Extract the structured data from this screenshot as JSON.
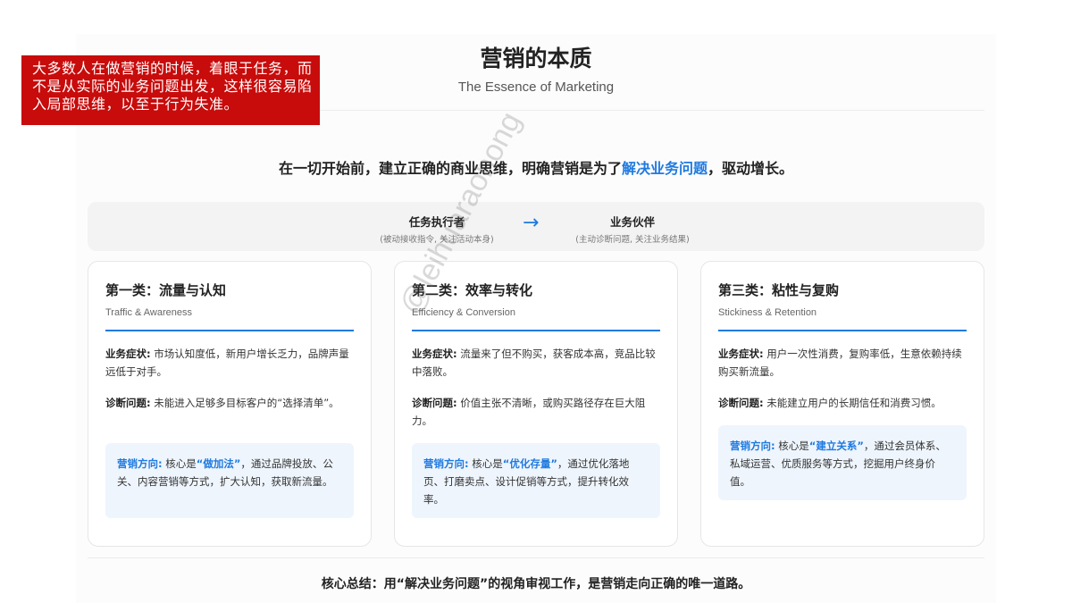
{
  "note": {
    "text": "大多数人在做营销的时候，着眼于任务，而不是从实际的业务问题出发，这样很容易陷入局部思维，以至于行为失准。"
  },
  "header": {
    "title": "营销的本质",
    "subtitle": "The Essence of Marketing"
  },
  "lead": {
    "before": "在一切开始前，建立正确的商业思维，明确营销是为了",
    "highlight": "解决业务问题",
    "after": "，驱动增长。"
  },
  "shift": {
    "from_title": "任务执行者",
    "from_desc": "(被动接收指令, 关注活动本身)",
    "arrow": "→",
    "to_title": "业务伙伴",
    "to_desc": "(主动诊断问题, 关注业务结果)"
  },
  "cards": [
    {
      "title": "第一类：流量与认知",
      "subtitle": "Traffic & Awareness",
      "symptom_label": "业务症状:",
      "symptom": " 市场认知度低，新用户增长乏力，品牌声量远低于对手。",
      "diagnosis_label": "诊断问题:",
      "diagnosis": " 未能进入足够多目标客户的“选择清单”。",
      "direction_label": "营销方向:",
      "direction_pre": " 核心是",
      "direction_kw": "“做加法”",
      "direction_post": "，通过品牌投放、公关、内容营销等方式，扩大认知，获取新流量。"
    },
    {
      "title": "第二类：效率与转化",
      "subtitle": "Efficiency & Conversion",
      "symptom_label": "业务症状:",
      "symptom": " 流量来了但不购买，获客成本高，竞品比较中落败。",
      "diagnosis_label": "诊断问题:",
      "diagnosis": " 价值主张不清晰，或购买路径存在巨大阻力。",
      "direction_label": "营销方向:",
      "direction_pre": " 核心是",
      "direction_kw": "“优化存量”",
      "direction_post": "，通过优化落地页、打磨卖点、设计促销等方式，提升转化效率。"
    },
    {
      "title": "第三类：粘性与复购",
      "subtitle": "Stickiness & Retention",
      "symptom_label": "业务症状:",
      "symptom": " 用户一次性消费，复购率低，生意依赖持续购买新流量。",
      "diagnosis_label": "诊断问题:",
      "diagnosis": " 未能建立用户的长期信任和消费习惯。",
      "direction_label": "营销方向:",
      "direction_pre": " 核心是",
      "direction_kw": "“建立关系”",
      "direction_post": "，通过会员体系、私域运营、优质服务等方式，挖掘用户终身价值。"
    }
  ],
  "summary": "核心总结：用“解决业务问题”的视角审视工作，是营销走向正确的唯一道路。",
  "watermark": "@leihuaraohong",
  "colors": {
    "accent": "#1f7ae0",
    "note_bg": "#c80b0b",
    "callout_bg": "#eef5fd"
  }
}
